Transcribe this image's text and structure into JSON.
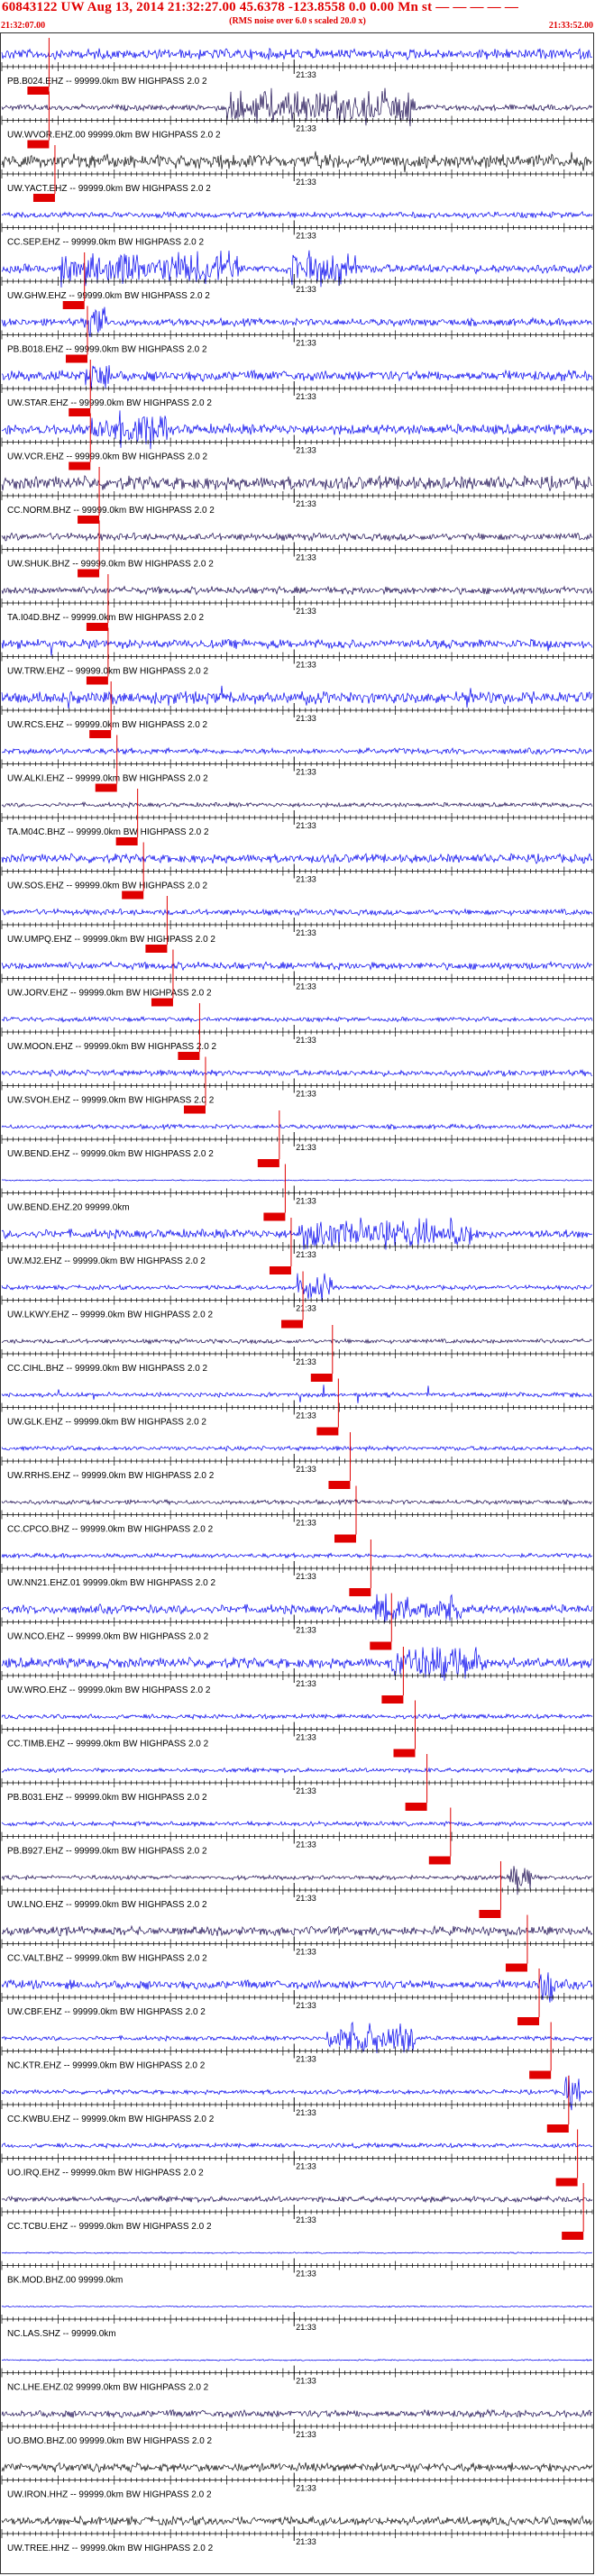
{
  "header": {
    "title": "60843122 UW Aug 13, 2014 21:32:27.00   45.6378 -123.8558  0.0 0.00 Mn st — — — — —",
    "subtitle": "(RMS noise over 6.0 s scaled 20.0 x)",
    "time_start": "21:32:07.00",
    "time_end": "21:33:52.00"
  },
  "minute_tick_label": "21:33",
  "colors": {
    "header_text": "#e00000",
    "trace_blue": "#0000ee",
    "trace_dark": "#1a0a50",
    "trace_black": "#111111",
    "pick_marker": "#e00000",
    "label_text": "#000000"
  },
  "traces": [
    {
      "label": "PB.B024.EHZ -- 99999.0km BW  HIGHPASS  2.0  2",
      "color": "blue",
      "amp": 0.35,
      "pick": 0.08
    },
    {
      "label": "UW.WVOR.EHZ.00 99999.0km BW  HIGHPASS  2.0  2",
      "color": "dark",
      "amp": 0.2,
      "pick": 0.08,
      "burst": [
        0.38,
        0.7,
        1.0
      ]
    },
    {
      "label": "UW.YACT.EHZ -- 99999.0km BW  HIGHPASS  2.0  2",
      "color": "black",
      "amp": 0.45,
      "pick": 0.09,
      "spiky": true
    },
    {
      "label": "CC.SEP.EHZ -- 99999.0km BW  HIGHPASS  2.0  2",
      "color": "blue",
      "amp": 0.2,
      "pick": null
    },
    {
      "label": "UW.GHW.EHZ -- 99999.0km BW  HIGHPASS  2.0  2",
      "color": "blue",
      "amp": 0.3,
      "pick": 0.14,
      "burst": [
        0.1,
        0.4,
        1.0
      ],
      "burst2": [
        0.49,
        0.6,
        1.0
      ]
    },
    {
      "label": "PB.B018.EHZ -- 99999.0km BW  HIGHPASS  2.0  2",
      "color": "blue",
      "amp": 0.25,
      "pick": 0.145,
      "burst": [
        0.14,
        0.18,
        0.8
      ]
    },
    {
      "label": "UW.STAR.EHZ -- 99999.0km BW  HIGHPASS  2.0  2",
      "color": "blue",
      "amp": 0.35,
      "pick": 0.15,
      "burst": [
        0.14,
        0.19,
        0.8
      ]
    },
    {
      "label": "UW.VCR.EHZ -- 99999.0km BW  HIGHPASS  2.0  2",
      "color": "blue",
      "amp": 0.35,
      "pick": 0.15,
      "burst": [
        0.15,
        0.28,
        1.0
      ]
    },
    {
      "label": "CC.NORM.BHZ -- 99999.0km BW  HIGHPASS  2.0  2",
      "color": "dark",
      "amp": 0.45,
      "pick": 0.165
    },
    {
      "label": "UW.SHUK.BHZ -- 99999.0km BW  HIGHPASS  2.0  2",
      "color": "dark",
      "amp": 0.25,
      "pick": 0.165
    },
    {
      "label": "TA.I04D.BHZ -- 99999.0km BW  HIGHPASS  2.0  2",
      "color": "dark",
      "amp": 0.25,
      "pick": 0.18
    },
    {
      "label": "UW.TRW.EHZ -- 99999.0km BW  HIGHPASS  2.0  2",
      "color": "blue",
      "amp": 0.3,
      "pick": 0.18,
      "spiky": true
    },
    {
      "label": "UW.RCS.EHZ -- 99999.0km BW  HIGHPASS  2.0  2",
      "color": "blue",
      "amp": 0.4,
      "pick": 0.185,
      "spiky": true
    },
    {
      "label": "UW.ALKI.EHZ -- 99999.0km BW  HIGHPASS  2.0  2",
      "color": "blue",
      "amp": 0.2,
      "pick": 0.195
    },
    {
      "label": "TA.M04C.BHZ -- 99999.0km BW  HIGHPASS  2.0  2",
      "color": "dark",
      "amp": 0.15,
      "pick": 0.23
    },
    {
      "label": "UW.SOS.EHZ -- 99999.0km BW  HIGHPASS  2.0  2",
      "color": "blue",
      "amp": 0.3,
      "pick": 0.24
    },
    {
      "label": "UW.UMPQ.EHZ -- 99999.0km BW  HIGHPASS  2.0  2",
      "color": "blue",
      "amp": 0.2,
      "pick": 0.28
    },
    {
      "label": "UW.JORV.EHZ -- 99999.0km BW  HIGHPASS  2.0  2",
      "color": "blue",
      "amp": 0.25,
      "pick": 0.29
    },
    {
      "label": "UW.MOON.EHZ -- 99999.0km BW  HIGHPASS  2.0  2",
      "color": "blue",
      "amp": 0.15,
      "pick": 0.335
    },
    {
      "label": "UW.SVOH.EHZ -- 99999.0km BW  HIGHPASS  2.0  2",
      "color": "blue",
      "amp": 0.2,
      "pick": 0.345
    },
    {
      "label": "UW.BEND.EHZ -- 99999.0km BW  HIGHPASS  2.0  2",
      "color": "blue",
      "amp": 0.15,
      "pick": 0.47
    },
    {
      "label": "UW.BEND.EHZ.20 99999.0km",
      "color": "blue",
      "amp": 0.05,
      "pick": 0.48,
      "flat": true
    },
    {
      "label": "UW.MJ2.EHZ -- 99999.0km BW  HIGHPASS  2.0  2",
      "color": "blue",
      "amp": 0.3,
      "pick": 0.49,
      "burst": [
        0.5,
        0.8,
        0.9
      ]
    },
    {
      "label": "UW.LKWY.EHZ -- 99999.0km BW  HIGHPASS  2.0  2",
      "color": "blue",
      "amp": 0.15,
      "pick": 0.51,
      "burst": [
        0.5,
        0.56,
        0.9
      ]
    },
    {
      "label": "CC.CIHL.BHZ -- 99999.0km BW  HIGHPASS  2.0  2",
      "color": "dark",
      "amp": 0.15,
      "pick": 0.56
    },
    {
      "label": "UW.GLK.EHZ -- 99999.0km BW  HIGHPASS  2.0  2",
      "color": "blue",
      "amp": 0.15,
      "pick": 0.57,
      "spiky": true
    },
    {
      "label": "UW.RRHS.EHZ -- 99999.0km BW  HIGHPASS  2.0  2",
      "color": "blue",
      "amp": 0.15,
      "pick": 0.59
    },
    {
      "label": "CC.CPCO.BHZ -- 99999.0km BW  HIGHPASS  2.0  2",
      "color": "dark",
      "amp": 0.15,
      "pick": 0.6
    },
    {
      "label": "UW.NN21.EHZ.01 99999.0km BW  HIGHPASS  2.0  2",
      "color": "blue",
      "amp": 0.15,
      "pick": 0.625
    },
    {
      "label": "UW.NCO.EHZ -- 99999.0km BW  HIGHPASS  2.0  2",
      "color": "blue",
      "amp": 0.3,
      "pick": 0.66,
      "burst": [
        0.63,
        0.78,
        0.9
      ]
    },
    {
      "label": "UW.WRO.EHZ -- 99999.0km BW  HIGHPASS  2.0  2",
      "color": "blue",
      "amp": 0.35,
      "pick": 0.68,
      "burst": [
        0.66,
        0.82,
        1.0
      ]
    },
    {
      "label": "CC.TIMB.EHZ -- 99999.0km BW  HIGHPASS  2.0  2",
      "color": "blue",
      "amp": 0.15,
      "pick": 0.7
    },
    {
      "label": "PB.B031.EHZ -- 99999.0km BW  HIGHPASS  2.0  2",
      "color": "blue",
      "amp": 0.15,
      "pick": 0.72
    },
    {
      "label": "PB.B927.EHZ -- 99999.0km BW  HIGHPASS  2.0  2",
      "color": "blue",
      "amp": 0.15,
      "pick": 0.76
    },
    {
      "label": "UW.LNO.EHZ -- 99999.0km BW  HIGHPASS  2.0  2",
      "color": "dark",
      "amp": 0.15,
      "pick": 0.845,
      "burst": [
        0.86,
        0.9,
        1.0
      ]
    },
    {
      "label": "CC.VALT.BHZ -- 99999.0km BW  HIGHPASS  2.0  2",
      "color": "dark",
      "amp": 0.3,
      "pick": 0.89
    },
    {
      "label": "UW.CBF.EHZ -- 99999.0km BW  HIGHPASS  2.0  2",
      "color": "blue",
      "amp": 0.3,
      "pick": 0.91,
      "burst": [
        0.91,
        0.94,
        1.0
      ]
    },
    {
      "label": "NC.KTR.EHZ -- 99999.0km BW  HIGHPASS  2.0  2",
      "color": "blue",
      "amp": 0.15,
      "pick": 0.93,
      "burst": [
        0.55,
        0.7,
        1.0
      ]
    },
    {
      "label": "CC.KWBU.EHZ -- 99999.0km BW  HIGHPASS  2.0  2",
      "color": "blue",
      "amp": 0.15,
      "pick": 0.96,
      "burst": [
        0.95,
        0.98,
        1.0
      ]
    },
    {
      "label": "UO.IRQ.EHZ -- 99999.0km BW  HIGHPASS  2.0  2",
      "color": "blue",
      "amp": 0.15,
      "pick": 0.975
    },
    {
      "label": "CC.TCBU.EHZ -- 99999.0km BW  HIGHPASS  2.0  2",
      "color": "dark",
      "amp": 0.2,
      "pick": 0.985
    },
    {
      "label": "BK.MOD.BHZ.00 99999.0km",
      "color": "blue",
      "amp": 0.0,
      "pick": null,
      "flat": true
    },
    {
      "label": "NC.LAS.SHZ -- 99999.0km",
      "color": "blue",
      "amp": 0.0,
      "pick": null,
      "flat": true
    },
    {
      "label": "NC.LHE.EHZ.02 99999.0km BW  HIGHPASS  2.0  2",
      "color": "blue",
      "amp": 0.05,
      "pick": null,
      "flat": true
    },
    {
      "label": "UO.BMO.BHZ.00 99999.0km BW  HIGHPASS  2.0  2",
      "color": "dark",
      "amp": 0.25,
      "pick": null
    },
    {
      "label": "UW.IRON.HHZ -- 99999.0km BW  HIGHPASS  2.0  2",
      "color": "black",
      "amp": 0.3,
      "pick": null
    },
    {
      "label": "UW.TREE.HHZ -- 99999.0km BW  HIGHPASS  2.0  2",
      "color": "black",
      "amp": 0.3,
      "pick": null
    }
  ]
}
